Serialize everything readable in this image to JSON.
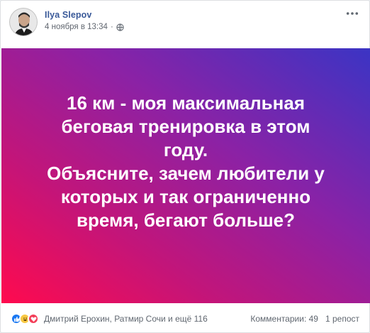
{
  "post": {
    "author_name": "Ilya Slepov",
    "timestamp": "4 ноября в 13:34",
    "separator": "·",
    "privacy_icon": "globe-icon",
    "more_icon": "more-horizontal-icon",
    "banner": {
      "text": "16 км - моя максимальная\nбеговая тренировка в этом\nгоду.\nОбъясните, зачем любители у\nкоторых и так ограниченно\nвремя, бегают больше?",
      "gradient_colors": [
        "#ff0a4e",
        "#c2157a",
        "#8a22a6",
        "#3b34c4"
      ]
    },
    "footer": {
      "reaction_icons": [
        "like-icon",
        "haha-icon",
        "love-icon"
      ],
      "reactors_text": "Дмитрий Ерохин, Ратмир Сочи и ещё 116",
      "comments_text": "Комментарии: 49",
      "shares_text": "1 репост"
    }
  },
  "colors": {
    "link": "#385898",
    "meta": "#616770",
    "like": "#1877f2",
    "haha": "#f7c843",
    "love": "#f33e58"
  }
}
